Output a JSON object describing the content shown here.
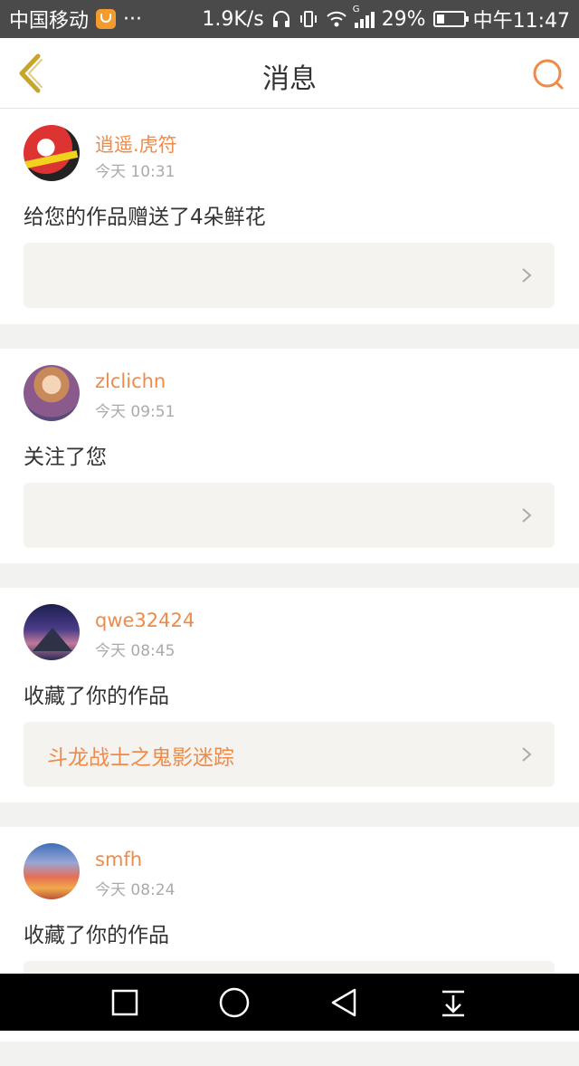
{
  "status_bar": {
    "carrier": "中国移动",
    "dots": "···",
    "speed": "1.9K/s",
    "network": "G",
    "battery": "29%",
    "time": "中午11:47"
  },
  "header": {
    "title": "消息",
    "back_icon": "chevron-left-icon",
    "search_icon": "search-icon"
  },
  "colors": {
    "accent": "#ef8b4a",
    "back": "#c8a52a"
  },
  "messages": [
    {
      "name": "逍遥.虎符",
      "time": "今天 10:31",
      "action": "给您的作品赠送了4朵鲜花",
      "ref": ""
    },
    {
      "name": "zlclichn",
      "time": "今天 09:51",
      "action": "关注了您",
      "ref": ""
    },
    {
      "name": "qwe32424",
      "time": "今天 08:45",
      "action": "收藏了你的作品",
      "ref": "斗龙战士之鬼影迷踪"
    },
    {
      "name": "smfh",
      "time": "今天 08:24",
      "action": "收藏了你的作品",
      "ref": ""
    }
  ],
  "nav_bar": {
    "recent_icon": "square-icon",
    "home_icon": "circle-icon",
    "back_icon": "triangle-back-icon",
    "notification_icon": "pull-down-icon"
  }
}
